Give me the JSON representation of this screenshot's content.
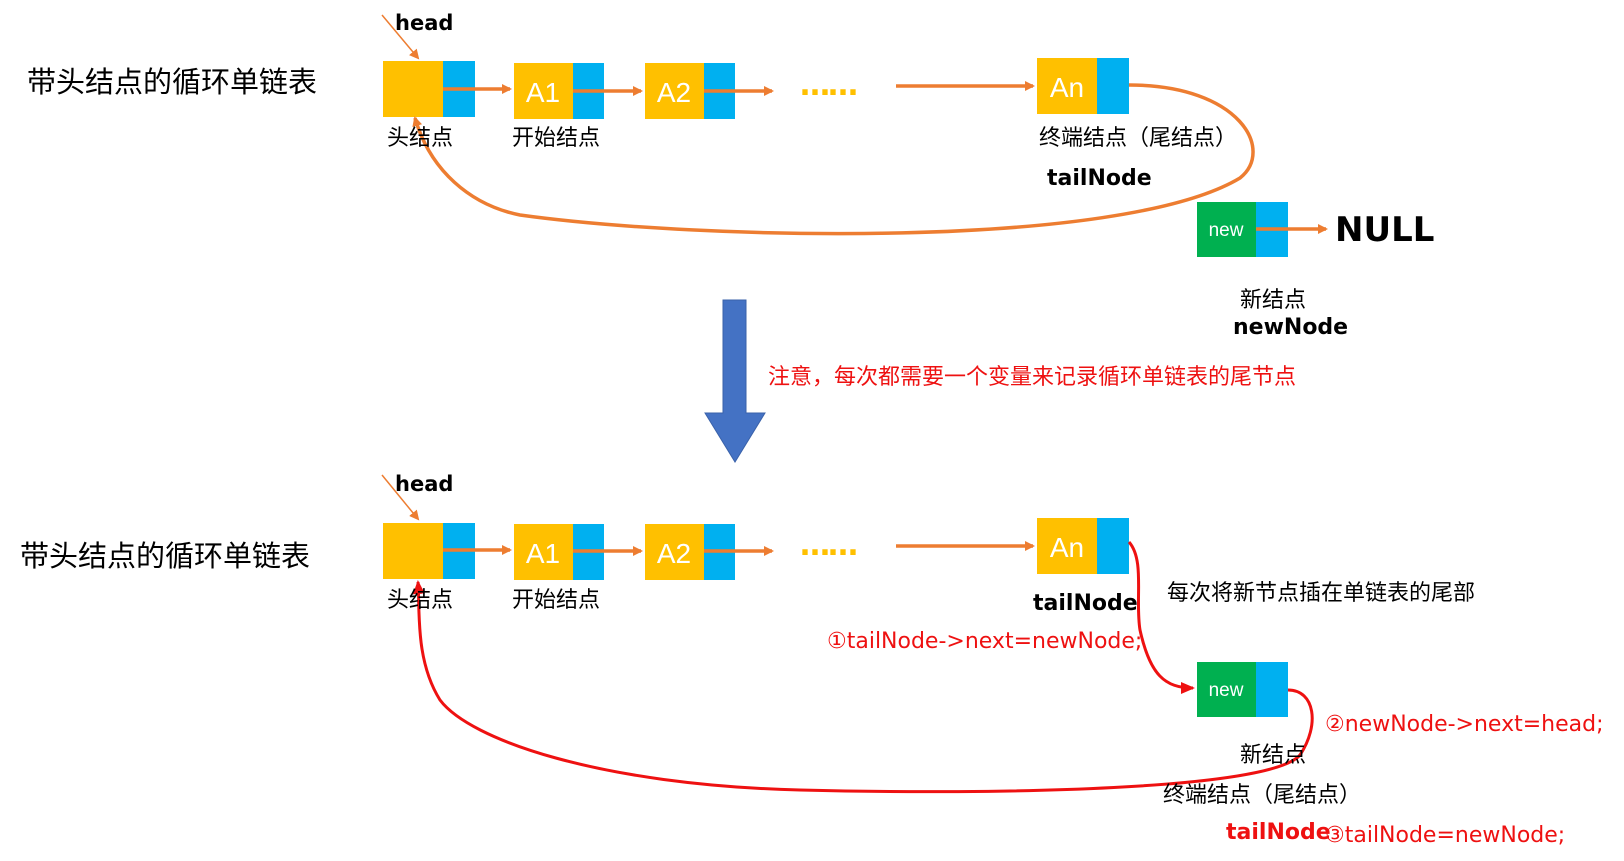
{
  "colors": {
    "node_data": "#ffc000",
    "node_pointer": "#00b0f0",
    "new_node": "#00b050",
    "arrow_orange": "#ed7d31",
    "arrow_red": "#ee1111",
    "down_arrow": "#4472c4"
  },
  "top": {
    "title": "带头结点的循环单链表",
    "head": "head",
    "nodes": [
      "",
      "A1",
      "A2",
      "An"
    ],
    "ellipsis": "……",
    "head_node_label": "头结点",
    "first_node_label": "开始结点",
    "tail_node_label": "终端结点（尾结点）",
    "tail_node_name": "tailNode",
    "new_node_text": "new",
    "null_text": "NULL",
    "new_node_label": "新结点",
    "new_node_name": "newNode"
  },
  "middle": {
    "note": "注意，每次都需要一个变量来记录循环单链表的尾节点"
  },
  "bottom": {
    "title": "带头结点的循环单链表",
    "head": "head",
    "nodes": [
      "",
      "A1",
      "A2",
      "An"
    ],
    "ellipsis": "……",
    "head_node_label": "头结点",
    "first_node_label": "开始结点",
    "tail_node_name": "tailNode",
    "insert_note": "每次将新节点插在单链表的尾部",
    "step1": "①tailNode->next=newNode;",
    "new_node_text": "new",
    "step2": "②newNode->next=head;",
    "new_node_label": "新结点",
    "tail_node_label": "终端结点（尾结点）",
    "tail_node_name_2": "tailNode",
    "step3": "③tailNode=newNode;"
  }
}
